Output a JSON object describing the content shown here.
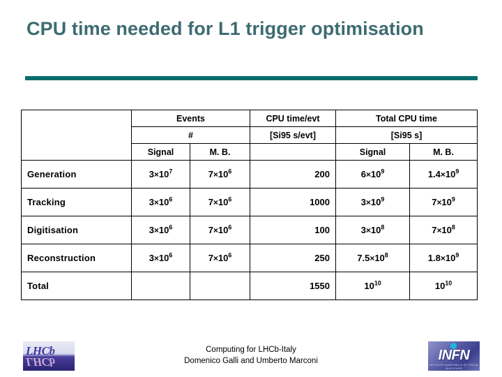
{
  "slide": {
    "title": "CPU time needed for L1 trigger optimisation",
    "accent_color": "#0a6c6c",
    "title_color": "#3d6b72"
  },
  "table": {
    "corner_cell": "",
    "header_groups": {
      "events": "Events",
      "cpu_time_per_evt": "CPU time/evt",
      "total_cpu_time": "Total CPU time"
    },
    "header_units": {
      "events": "#",
      "cpu_time_per_evt": "[Si95 s/evt]",
      "total_cpu_time": "[Si95 s]"
    },
    "header_sub": {
      "events_signal": "Signal",
      "events_mb": "M. B.",
      "cpu_blank": "",
      "total_signal": "Signal",
      "total_mb": "M. B."
    },
    "rows": [
      {
        "stage": "Generation",
        "events_signal": {
          "mantissa": "3",
          "base": "10",
          "exp": "7"
        },
        "events_mb": {
          "mantissa": "7",
          "base": "10",
          "exp": "6"
        },
        "cpu_time_per_evt": "200",
        "total_signal": {
          "mantissa": "6",
          "base": "10",
          "exp": "9"
        },
        "total_mb": {
          "mantissa": "1.4",
          "base": "10",
          "exp": "9"
        }
      },
      {
        "stage": "Tracking",
        "events_signal": {
          "mantissa": "3",
          "base": "10",
          "exp": "6"
        },
        "events_mb": {
          "mantissa": "7",
          "base": "10",
          "exp": "6"
        },
        "cpu_time_per_evt": "1000",
        "total_signal": {
          "mantissa": "3",
          "base": "10",
          "exp": "9"
        },
        "total_mb": {
          "mantissa": "7",
          "base": "10",
          "exp": "9"
        }
      },
      {
        "stage": "Digitisation",
        "events_signal": {
          "mantissa": "3",
          "base": "10",
          "exp": "6"
        },
        "events_mb": {
          "mantissa": "7",
          "base": "10",
          "exp": "6"
        },
        "cpu_time_per_evt": "100",
        "total_signal": {
          "mantissa": "3",
          "base": "10",
          "exp": "8"
        },
        "total_mb": {
          "mantissa": "7",
          "base": "10",
          "exp": "8"
        }
      },
      {
        "stage": "Reconstruction",
        "events_signal": {
          "mantissa": "3",
          "base": "10",
          "exp": "6"
        },
        "events_mb": {
          "mantissa": "7",
          "base": "10",
          "exp": "6"
        },
        "cpu_time_per_evt": "250",
        "total_signal": {
          "mantissa": "7.5",
          "base": "10",
          "exp": "8"
        },
        "total_mb": {
          "mantissa": "1.8",
          "base": "10",
          "exp": "9"
        }
      },
      {
        "stage": "Total",
        "events_signal": {
          "mantissa": "",
          "base": "",
          "exp": ""
        },
        "events_mb": {
          "mantissa": "",
          "base": "",
          "exp": ""
        },
        "cpu_time_per_evt": "1550",
        "total_signal": {
          "mantissa": "",
          "base": "10",
          "exp": "10"
        },
        "total_mb": {
          "mantissa": "",
          "base": "10",
          "exp": "10"
        }
      }
    ]
  },
  "footer": {
    "line1": "Computing for LHCb-Italy",
    "line2": "Domenico Galli and Umberto Marconi"
  },
  "logos": {
    "lhcb": {
      "text": "LHCb"
    },
    "infn": {
      "text": "INFN",
      "subtext": "ISTITUTO NAZIONALE DI FISICA NUCLEARE"
    }
  }
}
